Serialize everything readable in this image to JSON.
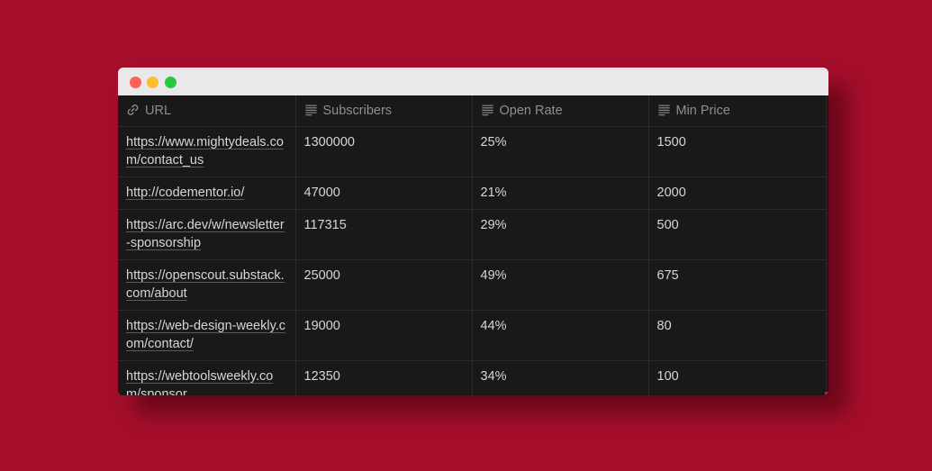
{
  "table": {
    "columns": [
      {
        "label": "URL",
        "icon": "link-icon"
      },
      {
        "label": "Subscribers",
        "icon": "text-lines-icon"
      },
      {
        "label": "Open Rate",
        "icon": "text-lines-icon"
      },
      {
        "label": "Min Price",
        "icon": "text-lines-icon"
      }
    ],
    "rows": [
      {
        "url": "https://www.mightydeals.com/contact_us",
        "subscribers": "1300000",
        "open_rate": "25%",
        "min_price": "1500"
      },
      {
        "url": "http://codementor.io/",
        "subscribers": "47000",
        "open_rate": "21%",
        "min_price": "2000"
      },
      {
        "url": "https://arc.dev/w/newsletter-sponsorship",
        "subscribers": "117315",
        "open_rate": "29%",
        "min_price": "500"
      },
      {
        "url": "https://openscout.substack.com/about",
        "subscribers": "25000",
        "open_rate": "49%",
        "min_price": "675"
      },
      {
        "url": "https://web-design-weekly.com/contact/",
        "subscribers": "19000",
        "open_rate": "44%",
        "min_price": "80"
      },
      {
        "url": "https://webtoolsweekly.com/sponsor",
        "subscribers": "12350",
        "open_rate": "34%",
        "min_price": "100"
      }
    ]
  },
  "colors": {
    "background": "#a40e2b",
    "window": "#191919",
    "titlebar": "#e9e9e9",
    "close": "#fe5f57",
    "minimize": "#febc2e",
    "maximize": "#28c840"
  }
}
